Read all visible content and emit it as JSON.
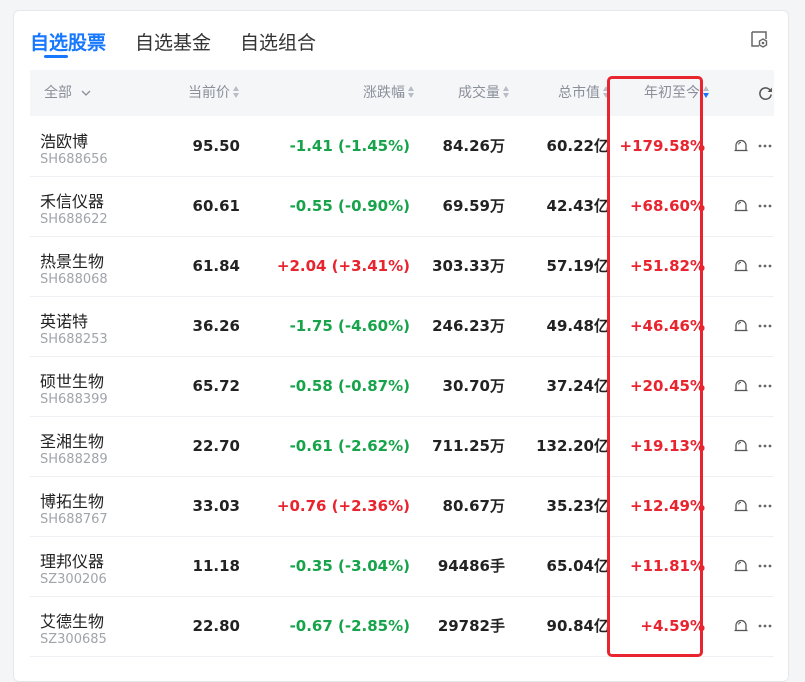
{
  "tabs": [
    {
      "label": "自选股票",
      "active": true
    },
    {
      "label": "自选基金",
      "active": false
    },
    {
      "label": "自选组合",
      "active": false
    }
  ],
  "header": {
    "all_label": "全部",
    "columns": {
      "price": "当前价",
      "change": "涨跌幅",
      "volume": "成交量",
      "market_cap": "总市值",
      "ytd": "年初至今"
    },
    "sorted_column": "ytd",
    "sort_direction": "desc"
  },
  "colors": {
    "accent": "#1677ff",
    "up": "#e8242f",
    "down": "#16a34a",
    "highlight": "#e8242f"
  },
  "rows": [
    {
      "name": "浩欧博",
      "code": "SH688656",
      "price": "95.50",
      "change": "-1.41 (-1.45%)",
      "volume": "84.26万",
      "market_cap": "60.22亿",
      "ytd": "+179.58%"
    },
    {
      "name": "禾信仪器",
      "code": "SH688622",
      "price": "60.61",
      "change": "-0.55 (-0.90%)",
      "volume": "69.59万",
      "market_cap": "42.43亿",
      "ytd": "+68.60%"
    },
    {
      "name": "热景生物",
      "code": "SH688068",
      "price": "61.84",
      "change": "+2.04 (+3.41%)",
      "volume": "303.33万",
      "market_cap": "57.19亿",
      "ytd": "+51.82%"
    },
    {
      "name": "英诺特",
      "code": "SH688253",
      "price": "36.26",
      "change": "-1.75 (-4.60%)",
      "volume": "246.23万",
      "market_cap": "49.48亿",
      "ytd": "+46.46%"
    },
    {
      "name": "硕世生物",
      "code": "SH688399",
      "price": "65.72",
      "change": "-0.58 (-0.87%)",
      "volume": "30.70万",
      "market_cap": "37.24亿",
      "ytd": "+20.45%"
    },
    {
      "name": "圣湘生物",
      "code": "SH688289",
      "price": "22.70",
      "change": "-0.61 (-2.62%)",
      "volume": "711.25万",
      "market_cap": "132.20亿",
      "ytd": "+19.13%"
    },
    {
      "name": "博拓生物",
      "code": "SH688767",
      "price": "33.03",
      "change": "+0.76 (+2.36%)",
      "volume": "80.67万",
      "market_cap": "35.23亿",
      "ytd": "+12.49%"
    },
    {
      "name": "理邦仪器",
      "code": "SZ300206",
      "price": "11.18",
      "change": "-0.35 (-3.04%)",
      "volume": "94486手",
      "market_cap": "65.04亿",
      "ytd": "+11.81%"
    },
    {
      "name": "艾德生物",
      "code": "SZ300685",
      "price": "22.80",
      "change": "-0.67 (-2.85%)",
      "volume": "29782手",
      "market_cap": "90.84亿",
      "ytd": "+4.59%"
    }
  ],
  "icons": {
    "settings": "settings-icon",
    "refresh": "refresh-icon",
    "alert": "bell-alert-icon",
    "more": "more-icon",
    "sort": "sort-icon",
    "dropdown": "chevron-down-icon"
  }
}
